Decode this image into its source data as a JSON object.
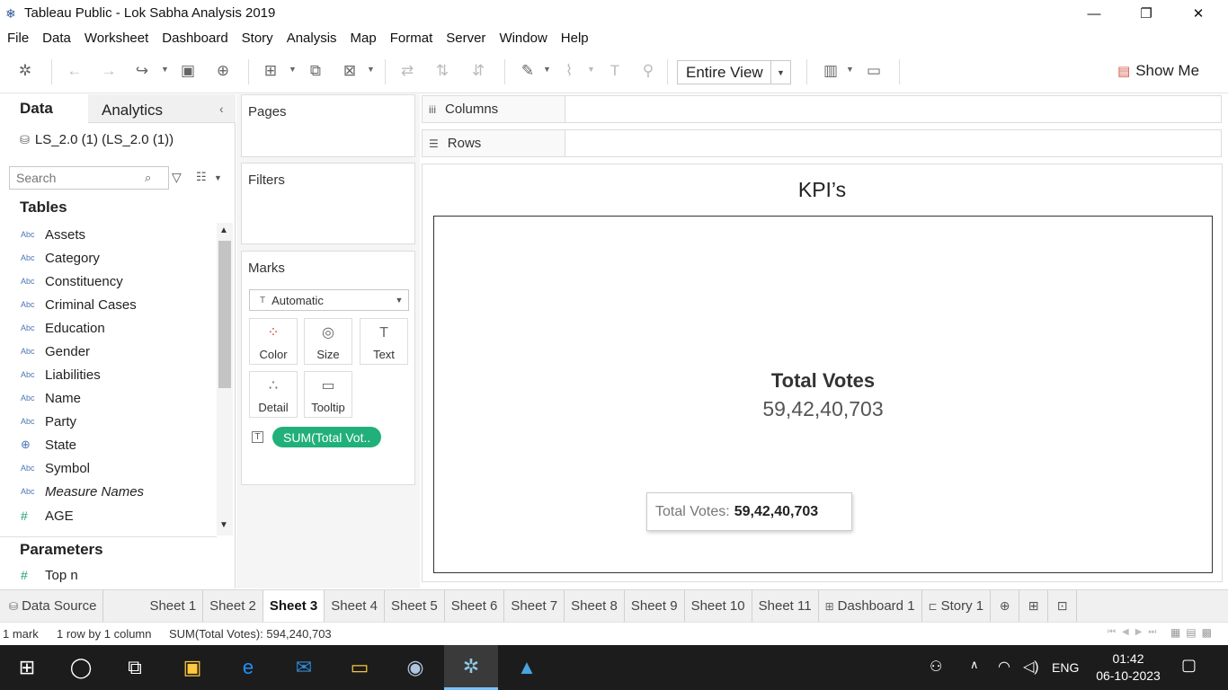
{
  "window": {
    "title": "Tableau Public - Lok Sabha Analysis 2019",
    "minimize": "—",
    "restore": "❐",
    "close": "✕"
  },
  "menu": [
    "File",
    "Data",
    "Worksheet",
    "Dashboard",
    "Story",
    "Analysis",
    "Map",
    "Format",
    "Server",
    "Window",
    "Help"
  ],
  "toolbar": {
    "fit_select": "Entire View",
    "show_me": "Show Me"
  },
  "data_pane": {
    "tab_data": "Data",
    "tab_analytics": "Analytics",
    "datasource": "LS_2.0 (1) (LS_2.0 (1))",
    "search_placeholder": "Search",
    "tables_heading": "Tables",
    "fields": [
      {
        "type": "Abc",
        "name": "Assets"
      },
      {
        "type": "Abc",
        "name": "Category"
      },
      {
        "type": "Abc",
        "name": "Constituency"
      },
      {
        "type": "Abc",
        "name": "Criminal Cases"
      },
      {
        "type": "Abc",
        "name": "Education"
      },
      {
        "type": "Abc",
        "name": "Gender"
      },
      {
        "type": "Abc",
        "name": "Liabilities"
      },
      {
        "type": "Abc",
        "name": "Name"
      },
      {
        "type": "Abc",
        "name": "Party"
      },
      {
        "type": "geo",
        "name": "State"
      },
      {
        "type": "Abc",
        "name": "Symbol"
      },
      {
        "type": "Abc",
        "name": "Measure Names"
      },
      {
        "type": "#",
        "name": "AGE"
      }
    ],
    "parameters_heading": "Parameters",
    "parameter": {
      "type": "#",
      "name": "Top n"
    }
  },
  "shelves": {
    "pages": "Pages",
    "filters": "Filters",
    "marks": "Marks",
    "mark_type": "Automatic",
    "mark_buttons": [
      "Color",
      "Size",
      "Text",
      "Detail",
      "Tooltip"
    ],
    "pill": "SUM(Total Vot..",
    "columns": "Columns",
    "rows": "Rows"
  },
  "canvas": {
    "title": "KPI’s",
    "kpi_label": "Total Votes",
    "kpi_value": "59,42,40,703",
    "tooltip_label": "Total Votes:",
    "tooltip_value": "59,42,40,703"
  },
  "tabs": {
    "data_source": "Data Source",
    "sheets": [
      "Sheet 1",
      "Sheet 2",
      "Sheet 3",
      "Sheet 4",
      "Sheet 5",
      "Sheet 6",
      "Sheet 7",
      "Sheet 8",
      "Sheet 9",
      "Sheet 10",
      "Sheet 11"
    ],
    "active": "Sheet 3",
    "dashboard": "Dashboard 1",
    "story": "Story 1"
  },
  "status": {
    "marks": "1 mark",
    "dims": "1 row by 1 column",
    "sum": "SUM(Total Votes): 594,240,703"
  },
  "taskbar": {
    "language": "ENG",
    "time": "01:42",
    "date": "06-10-2023"
  },
  "colors": {
    "pill_green": "#21b07a",
    "taskbar": "#1c1c1c",
    "show_me_icon": "#d4584a"
  }
}
